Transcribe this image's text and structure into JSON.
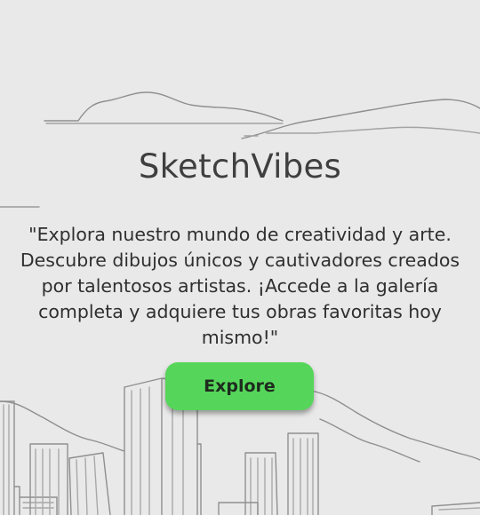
{
  "hero": {
    "title": "SketchVibes",
    "tagline": "\"Explora nuestro mundo de creatividad y arte. Descubre dibujos únicos y cautivadores creados por talentosos artistas. ¡Accede a la galería completa y adquiere tus obras favoritas hoy mismo!\"",
    "cta_label": "Explore"
  },
  "colors": {
    "background": "#e9e9e9",
    "cta": "#55d65a",
    "title": "#3f3f3f",
    "sketch_line": "#8f8f8f"
  },
  "background_illustration": "hand-drawn-cityscape-with-hills"
}
